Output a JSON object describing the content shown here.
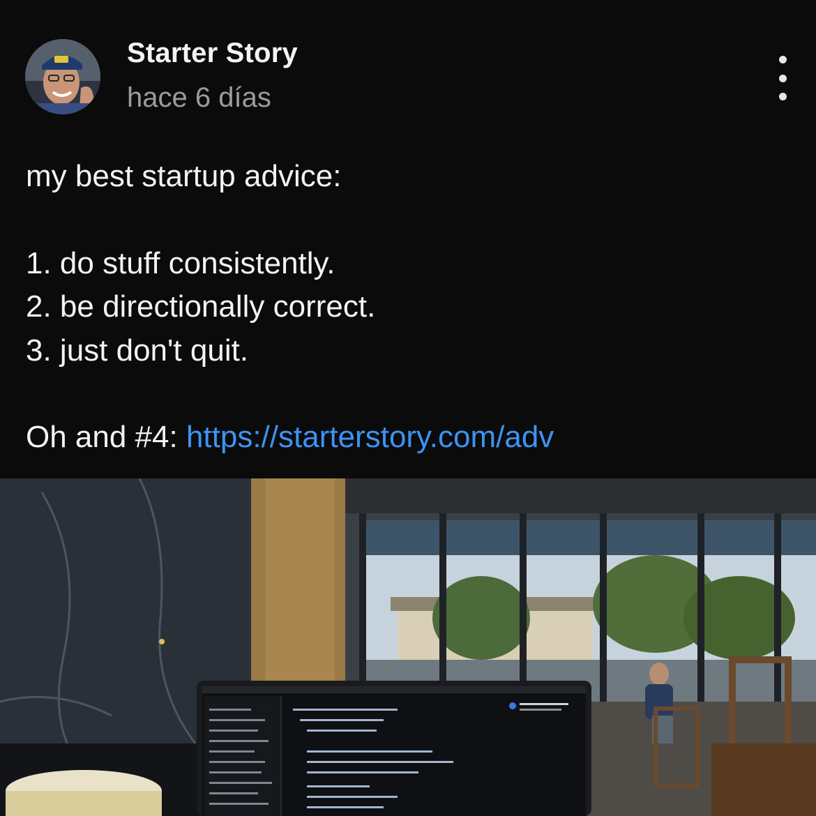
{
  "post": {
    "author": "Starter Story",
    "time": "hace 6 días",
    "lines": {
      "intro": "my best startup advice:",
      "item1": "1. do stuff consistently.",
      "item2": "2. be directionally correct.",
      "item3": "3. just don't quit.",
      "outro_prefix": "Oh and #4: ",
      "link_text": "https://starterstory.com/adv"
    },
    "link_color": "#3d93f4"
  },
  "icons": {
    "more": "more-vertical-icon",
    "avatar": "profile-photo"
  },
  "image": {
    "description_icon": "photo-laptop-cafe"
  }
}
